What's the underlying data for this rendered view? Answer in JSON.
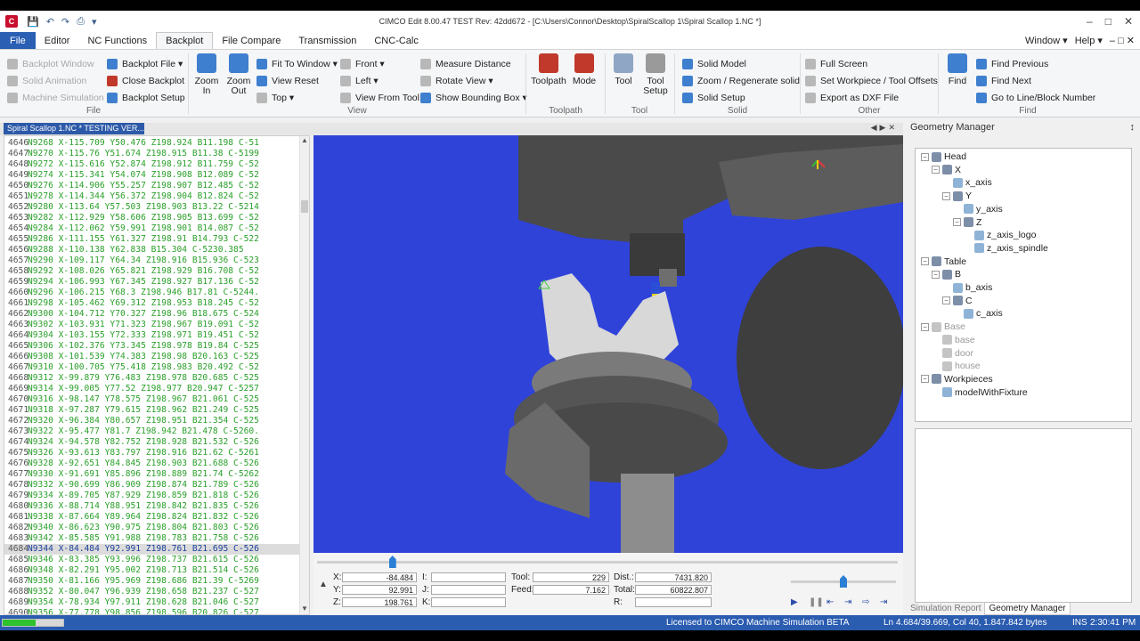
{
  "window": {
    "title": "CIMCO Edit 8.00.47 TEST Rev: 42dd672 - [C:\\Users\\Connor\\Desktop\\SpiralScallop 1\\Spiral Scallop 1.NC *]",
    "controls": [
      "–",
      "□",
      "✕"
    ]
  },
  "menubar": {
    "tabs": [
      "File",
      "Editor",
      "NC Functions",
      "Backplot",
      "File Compare",
      "Transmission",
      "CNC-Calc"
    ],
    "right": [
      "Window ▾",
      "Help ▾",
      "– □ ✕"
    ]
  },
  "ribbon": {
    "file_group": {
      "title": "File",
      "items": [
        "Backplot Window",
        "Solid Animation",
        "Machine Simulation",
        "Backplot File ▾",
        "Close Backplot",
        "Backplot Setup"
      ]
    },
    "view_group": {
      "title": "View",
      "zoom_in": "Zoom In",
      "zoom_out": "Zoom Out",
      "items": [
        "Fit To Window ▾",
        "View Reset",
        "Top ▾",
        "Front ▾",
        "Left ▾",
        "View From Tool",
        "Measure Distance",
        "Rotate View ▾",
        "Show Bounding Box ▾"
      ]
    },
    "toolpath_group": {
      "title": "Toolpath",
      "toolpath": "Toolpath",
      "mode": "Mode"
    },
    "tool_group": {
      "title": "Tool",
      "tool": "Tool",
      "tool_setup": "Tool Setup"
    },
    "solid_group": {
      "title": "Solid",
      "items": [
        "Solid Model",
        "Zoom / Regenerate solid",
        "Solid Setup"
      ]
    },
    "other_group": {
      "title": "Other",
      "items": [
        "Full Screen",
        "Set Workpiece / Tool Offsets",
        "Export as DXF File"
      ]
    },
    "find_group": {
      "title": "Find",
      "find": "Find",
      "items": [
        "Find Previous",
        "Find Next",
        "Go to Line/Block Number"
      ]
    }
  },
  "document_tab": {
    "label": "Spiral Scallop 1.NC * TESTING VER..."
  },
  "editor": {
    "highlight_line": "4684",
    "lines": [
      {
        "n": "4646",
        "code": "N9268 X-115.709 Y50.476 Z198.924 B11.198 C-51"
      },
      {
        "n": "4647",
        "code": "N9270 X-115.76 Y51.674 Z198.915 B11.38 C-5199"
      },
      {
        "n": "4648",
        "code": "N9272 X-115.616 Y52.874 Z198.912 B11.759 C-52"
      },
      {
        "n": "4649",
        "code": "N9274 X-115.341 Y54.074 Z198.908 B12.089 C-52"
      },
      {
        "n": "4650",
        "code": "N9276 X-114.906 Y55.257 Z198.907 B12.485 C-52"
      },
      {
        "n": "4651",
        "code": "N9278 X-114.344 Y56.372 Z198.904 B12.824 C-52"
      },
      {
        "n": "4652",
        "code": "N9280 X-113.64 Y57.503 Z198.903 B13.22 C-5214"
      },
      {
        "n": "4653",
        "code": "N9282 X-112.929 Y58.606 Z198.905 B13.699 C-52"
      },
      {
        "n": "4654",
        "code": "N9284 X-112.062 Y59.991 Z198.901 B14.087 C-52"
      },
      {
        "n": "4655",
        "code": "N9286 X-111.155 Y61.327 Z198.91 B14.793 C-522"
      },
      {
        "n": "4656",
        "code": "N9288 X-110.138 Y62.838 B15.304 C-5230.385"
      },
      {
        "n": "4657",
        "code": "N9290 X-109.117 Y64.34 Z198.916 B15.936 C-523"
      },
      {
        "n": "4658",
        "code": "N9292 X-108.026 Y65.821 Z198.929 B16.708 C-52"
      },
      {
        "n": "4659",
        "code": "N9294 X-106.993 Y67.345 Z198.927 B17.136 C-52"
      },
      {
        "n": "4660",
        "code": "N9296 X-106.215 Y68.3 Z198.946 B17.81 C-5244."
      },
      {
        "n": "4661",
        "code": "N9298 X-105.462 Y69.312 Z198.953 B18.245 C-52"
      },
      {
        "n": "4662",
        "code": "N9300 X-104.712 Y70.327 Z198.96 B18.675 C-524"
      },
      {
        "n": "4663",
        "code": "N9302 X-103.931 Y71.323 Z198.967 B19.091 C-52"
      },
      {
        "n": "4664",
        "code": "N9304 X-103.155 Y72.333 Z198.971 B19.451 C-52"
      },
      {
        "n": "4665",
        "code": "N9306 X-102.376 Y73.345 Z198.978 B19.84 C-525"
      },
      {
        "n": "4666",
        "code": "N9308 X-101.539 Y74.383 Z198.98 B20.163 C-525"
      },
      {
        "n": "4667",
        "code": "N9310 X-100.705 Y75.418 Z198.983 B20.492 C-52"
      },
      {
        "n": "4668",
        "code": "N9312 X-99.879 Y76.483 Z198.978 B20.685 C-525"
      },
      {
        "n": "4669",
        "code": "N9314 X-99.005 Y77.52 Z198.977 B20.947 C-5257"
      },
      {
        "n": "4670",
        "code": "N9316 X-98.147 Y78.575 Z198.967 B21.061 C-525"
      },
      {
        "n": "4671",
        "code": "N9318 X-97.287 Y79.615 Z198.962 B21.249 C-525"
      },
      {
        "n": "4672",
        "code": "N9320 X-96.384 Y80.657 Z198.951 B21.354 C-525"
      },
      {
        "n": "4673",
        "code": "N9322 X-95.477 Y81.7 Z198.942 B21.478 C-5260."
      },
      {
        "n": "4674",
        "code": "N9324 X-94.578 Y82.752 Z198.928 B21.532 C-526"
      },
      {
        "n": "4675",
        "code": "N9326 X-93.613 Y83.797 Z198.916 B21.62 C-5261"
      },
      {
        "n": "4676",
        "code": "N9328 X-92.651 Y84.845 Z198.903 B21.688 C-526"
      },
      {
        "n": "4677",
        "code": "N9330 X-91.691 Y85.896 Z198.889 B21.74 C-5262"
      },
      {
        "n": "4678",
        "code": "N9332 X-90.699 Y86.909 Z198.874 B21.789 C-526"
      },
      {
        "n": "4679",
        "code": "N9334 X-89.705 Y87.929 Z198.859 B21.818 C-526"
      },
      {
        "n": "4680",
        "code": "N9336 X-88.714 Y88.951 Z198.842 B21.835 C-526"
      },
      {
        "n": "4681",
        "code": "N9338 X-87.664 Y89.964 Z198.824 B21.832 C-526"
      },
      {
        "n": "4682",
        "code": "N9340 X-86.623 Y90.975 Z198.804 B21.803 C-526"
      },
      {
        "n": "4683",
        "code": "N9342 X-85.585 Y91.988 Z198.783 B21.758 C-526"
      },
      {
        "n": "4684",
        "code": "N9344 X-84.484 Y92.991 Z198.761 B21.695 C-526"
      },
      {
        "n": "4685",
        "code": "N9346 X-83.385 Y93.996 Z198.737 B21.615 C-526"
      },
      {
        "n": "4686",
        "code": "N9348 X-82.291 Y95.002 Z198.713 B21.514 C-526"
      },
      {
        "n": "4687",
        "code": "N9350 X-81.166 Y95.969 Z198.686 B21.39 C-5269"
      },
      {
        "n": "4688",
        "code": "N9352 X-80.047 Y96.939 Z198.658 B21.237 C-527"
      },
      {
        "n": "4689",
        "code": "N9354 X-78.934 Y97.911 Z198.628 B21.046 C-527"
      },
      {
        "n": "4690",
        "code": "N9356 X-77.778 Y98.856 Z198.596 B20.826 C-527"
      }
    ]
  },
  "controls": {
    "x_label": "X:",
    "x_value": "-84.484",
    "y_label": "Y:",
    "y_value": "92.991",
    "z_label": "Z:",
    "z_value": "198.761",
    "i_label": "I:",
    "j_label": "J:",
    "k_label": "K:",
    "tool_label": "Tool:",
    "tool_value": "229",
    "feed_label": "Feed:",
    "feed_value": "7.162",
    "dist_label": "Dist.:",
    "dist_value": "7431.820",
    "total_label": "Total:",
    "total_value": "60822.807",
    "r_label": "R:",
    "progress_fraction": 0.13,
    "speed_fraction": 0.5
  },
  "geometry_manager": {
    "title": "Geometry Manager",
    "pin": "↕",
    "tree": [
      {
        "label": "Head",
        "level": 0,
        "disabled": false,
        "exp": "−"
      },
      {
        "label": "X",
        "level": 1,
        "disabled": false,
        "exp": "−"
      },
      {
        "label": "x_axis",
        "level": 2,
        "disabled": false,
        "exp": ""
      },
      {
        "label": "Y",
        "level": 2,
        "disabled": false,
        "exp": "−"
      },
      {
        "label": "y_axis",
        "level": 3,
        "disabled": false,
        "exp": ""
      },
      {
        "label": "Z",
        "level": 3,
        "disabled": false,
        "exp": "−"
      },
      {
        "label": "z_axis_logo",
        "level": 4,
        "disabled": false,
        "exp": ""
      },
      {
        "label": "z_axis_spindle",
        "level": 4,
        "disabled": false,
        "exp": ""
      },
      {
        "label": "Table",
        "level": 0,
        "disabled": false,
        "exp": "−"
      },
      {
        "label": "B",
        "level": 1,
        "disabled": false,
        "exp": "−"
      },
      {
        "label": "b_axis",
        "level": 2,
        "disabled": false,
        "exp": ""
      },
      {
        "label": "C",
        "level": 2,
        "disabled": false,
        "exp": "−"
      },
      {
        "label": "c_axis",
        "level": 3,
        "disabled": false,
        "exp": ""
      },
      {
        "label": "Base",
        "level": 0,
        "disabled": true,
        "exp": "−"
      },
      {
        "label": "base",
        "level": 1,
        "disabled": true,
        "exp": ""
      },
      {
        "label": "door",
        "level": 1,
        "disabled": true,
        "exp": ""
      },
      {
        "label": "house",
        "level": 1,
        "disabled": true,
        "exp": ""
      },
      {
        "label": "Workpieces",
        "level": 0,
        "disabled": false,
        "exp": "−"
      },
      {
        "label": "modelWithFixture",
        "level": 1,
        "disabled": false,
        "exp": ""
      }
    ],
    "tabs": [
      "Simulation Report",
      "Geometry Manager"
    ]
  },
  "statusbar": {
    "license": "Licensed to CIMCO Machine Simulation BETA",
    "position": "Ln 4.684/39.669, Col 40, 1.847.842 bytes",
    "mode": "INS",
    "time": "2:30:41 PM"
  },
  "colors": {
    "accent": "#2b5fb4",
    "viewport_bg": "#2f43d9",
    "code_green": "#2aa02a",
    "status_bar": "#2a5cb0"
  }
}
